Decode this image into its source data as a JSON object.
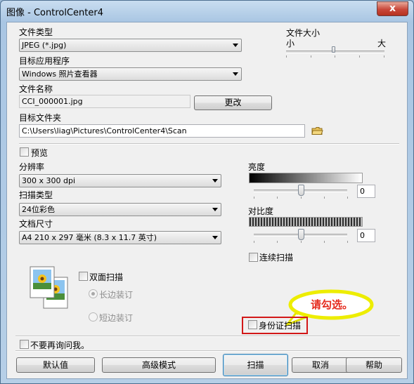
{
  "window": {
    "title": "图像 - ControlCenter4",
    "close_glyph": "x"
  },
  "file_type": {
    "label": "文件类型",
    "value": "JPEG (*.jpg)"
  },
  "file_size": {
    "label": "文件大小",
    "small_label": "小",
    "large_label": "大",
    "level": 0.5
  },
  "target_app": {
    "label": "目标应用程序",
    "value": "Windows 照片查看器"
  },
  "file_name": {
    "label": "文件名称",
    "value": "CCI_000001.jpg",
    "change_button": "更改"
  },
  "target_folder": {
    "label": "目标文件夹",
    "value": "C:\\Users\\liag\\Pictures\\ControlCenter4\\Scan"
  },
  "preview": {
    "label": "预览",
    "checked": false
  },
  "resolution": {
    "label": "分辨率",
    "value": "300 x 300 dpi"
  },
  "scan_type": {
    "label": "扫描类型",
    "value": "24位彩色"
  },
  "document_size": {
    "label": "文档尺寸",
    "value": "A4 210 x 297 毫米 (8.3 x 11.7 英寸)"
  },
  "brightness": {
    "label": "亮度",
    "value": "0",
    "level": 0.5
  },
  "contrast": {
    "label": "对比度",
    "value": "0",
    "level": 0.5
  },
  "continuous_scan": {
    "label": "连续扫描",
    "checked": false
  },
  "duplex": {
    "label": "双面扫描",
    "checked": false,
    "long_edge_label": "长边装订",
    "short_edge_label": "短边装订"
  },
  "callout": {
    "text": "请勾选。",
    "color": "#e52b1e",
    "bubble_color": "#ffff00"
  },
  "id_card_scan": {
    "label": "身份证扫描",
    "checked": false,
    "highlight_color": "#d21818"
  },
  "dont_ask": {
    "label": "不要再询问我。",
    "checked": false
  },
  "buttons": {
    "default": "默认值",
    "advanced": "高级模式",
    "scan": "扫描",
    "cancel": "取消",
    "help": "帮助"
  }
}
